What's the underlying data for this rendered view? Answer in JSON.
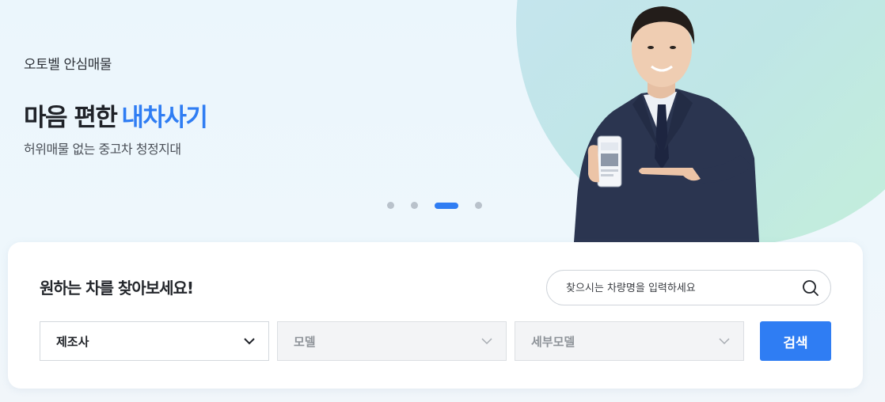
{
  "hero": {
    "eyebrow": "오토벨 안심매물",
    "headline_main": "마음 편한",
    "headline_accent": "내차사기",
    "subline": "허위매물 없는 중고차 청정지대",
    "carousel": {
      "total": 4,
      "active_index": 3
    }
  },
  "search": {
    "title": "원하는 차를 찾아보세요!",
    "input_placeholder": "찾으시는 차량명을 입력하세요",
    "manufacturer_label": "제조사",
    "model_label": "모델",
    "detail_model_label": "세부모델",
    "submit_label": "검색"
  },
  "colors": {
    "accent": "#2f7df3"
  }
}
